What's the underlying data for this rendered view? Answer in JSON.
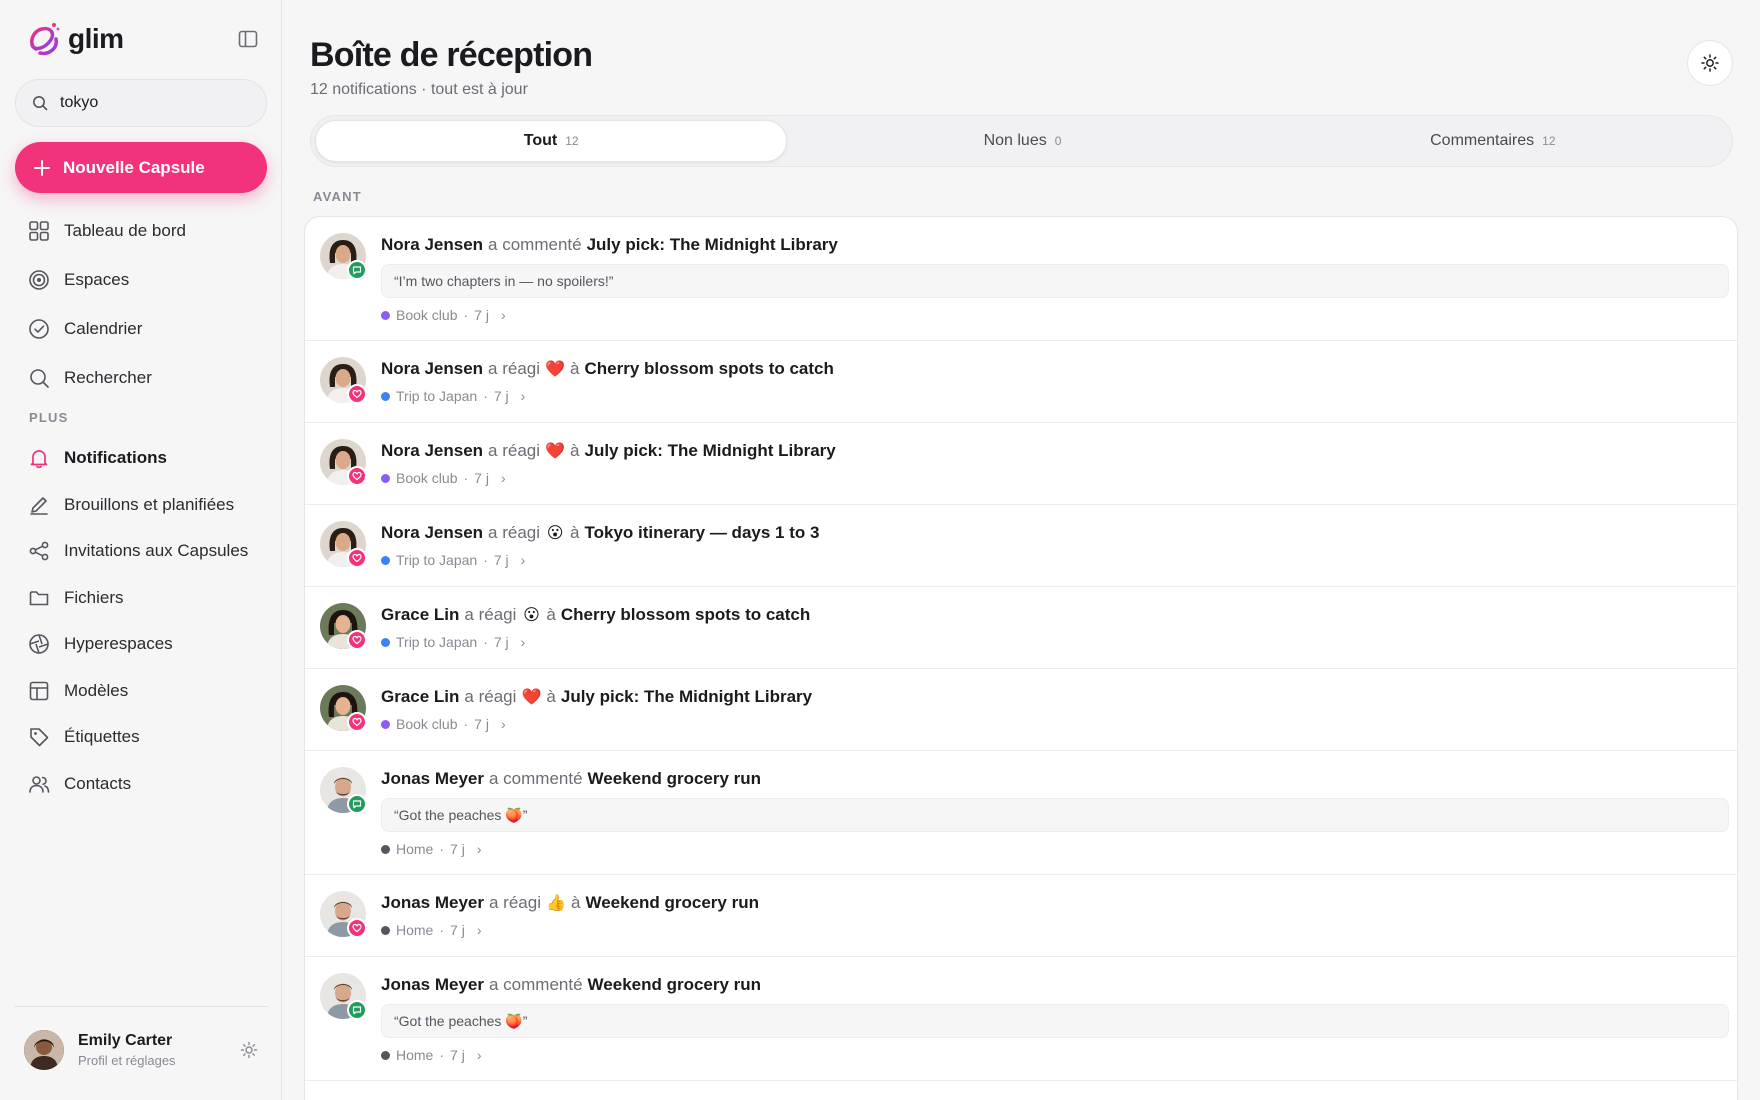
{
  "brand": {
    "name": "glim"
  },
  "search": {
    "value": "tokyo",
    "placeholder": "Rechercher"
  },
  "new_button": {
    "label": "Nouvelle Capsule"
  },
  "nav_main": [
    {
      "label": "Tableau de bord",
      "icon": "grid-icon"
    },
    {
      "label": "Espaces",
      "icon": "target-icon"
    },
    {
      "label": "Calendrier",
      "icon": "check-circle-icon"
    },
    {
      "label": "Rechercher",
      "icon": "search-icon"
    }
  ],
  "nav_section_label": "PLUS",
  "nav_more": [
    {
      "label": "Notifications",
      "icon": "bell-icon",
      "active": true
    },
    {
      "label": "Brouillons et planifiées",
      "icon": "pencil-icon"
    },
    {
      "label": "Invitations aux Capsules",
      "icon": "share-icon"
    },
    {
      "label": "Fichiers",
      "icon": "folder-icon"
    },
    {
      "label": "Hyperespaces",
      "icon": "aperture-icon"
    },
    {
      "label": "Modèles",
      "icon": "layout-icon"
    },
    {
      "label": "Étiquettes",
      "icon": "tag-icon"
    },
    {
      "label": "Contacts",
      "icon": "users-icon"
    }
  ],
  "profile": {
    "name": "Emily Carter",
    "subtitle": "Profil et réglages"
  },
  "page": {
    "title": "Boîte de réception",
    "subtitle": "12 notifications · tout est à jour"
  },
  "tabs": [
    {
      "label": "Tout",
      "count": "12",
      "active": true
    },
    {
      "label": "Non lues",
      "count": "0"
    },
    {
      "label": "Commentaires",
      "count": "12"
    }
  ],
  "group_label": "AVANT",
  "colors": {
    "accent": "#f2337b",
    "comment_badge": "#1f9d5a",
    "book_club": "#8b5cf6",
    "trip": "#3b82f6",
    "home": "#55555e"
  },
  "notifications": [
    {
      "who": "Nora Jensen",
      "verb": "a commenté",
      "emoji": "",
      "prep": "",
      "target": "July pick: The Midnight Library",
      "quote": "“I’m two chapters in — no spoilers!”",
      "space": "Book club",
      "space_color": "#8b5cf6",
      "time": "7 j",
      "type": "comment",
      "person": "nora"
    },
    {
      "who": "Nora Jensen",
      "verb": "a réagi",
      "emoji": "❤️",
      "prep": "à",
      "target": "Cherry blossom spots to catch",
      "quote": "",
      "space": "Trip to Japan",
      "space_color": "#3b82f6",
      "time": "7 j",
      "type": "react",
      "person": "nora"
    },
    {
      "who": "Nora Jensen",
      "verb": "a réagi",
      "emoji": "❤️",
      "prep": "à",
      "target": "July pick: The Midnight Library",
      "quote": "",
      "space": "Book club",
      "space_color": "#8b5cf6",
      "time": "7 j",
      "type": "react",
      "person": "nora"
    },
    {
      "who": "Nora Jensen",
      "verb": "a réagi",
      "emoji": "😮",
      "prep": "à",
      "target": "Tokyo itinerary — days 1 to 3",
      "quote": "",
      "space": "Trip to Japan",
      "space_color": "#3b82f6",
      "time": "7 j",
      "type": "react",
      "person": "nora"
    },
    {
      "who": "Grace Lin",
      "verb": "a réagi",
      "emoji": "😮",
      "prep": "à",
      "target": "Cherry blossom spots to catch",
      "quote": "",
      "space": "Trip to Japan",
      "space_color": "#3b82f6",
      "time": "7 j",
      "type": "react",
      "person": "grace"
    },
    {
      "who": "Grace Lin",
      "verb": "a réagi",
      "emoji": "❤️",
      "prep": "à",
      "target": "July pick: The Midnight Library",
      "quote": "",
      "space": "Book club",
      "space_color": "#8b5cf6",
      "time": "7 j",
      "type": "react",
      "person": "grace"
    },
    {
      "who": "Jonas Meyer",
      "verb": "a commenté",
      "emoji": "",
      "prep": "",
      "target": "Weekend grocery run",
      "quote": "“Got the peaches 🍑”",
      "space": "Home",
      "space_color": "#55555e",
      "time": "7 j",
      "type": "comment",
      "person": "jonas"
    },
    {
      "who": "Jonas Meyer",
      "verb": "a réagi",
      "emoji": "👍",
      "prep": "à",
      "target": "Weekend grocery run",
      "quote": "",
      "space": "Home",
      "space_color": "#55555e",
      "time": "7 j",
      "type": "react",
      "person": "jonas"
    },
    {
      "who": "Jonas Meyer",
      "verb": "a commenté",
      "emoji": "",
      "prep": "",
      "target": "Weekend grocery run",
      "quote": "“Got the peaches 🍑”",
      "space": "Home",
      "space_color": "#55555e",
      "time": "7 j",
      "type": "comment",
      "person": "jonas"
    }
  ]
}
